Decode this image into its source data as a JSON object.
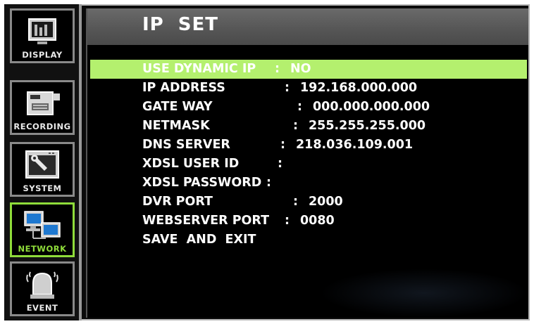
{
  "sidebar": {
    "items": [
      {
        "label": "DISPLAY",
        "icon": "display-icon",
        "active": false
      },
      {
        "label": "RECORDING",
        "icon": "camera-icon",
        "active": false
      },
      {
        "label": "SYSTEM",
        "icon": "wrench-icon",
        "active": false
      },
      {
        "label": "NETWORK",
        "icon": "network-icon",
        "active": true
      },
      {
        "label": "EVENT",
        "icon": "alarm-icon",
        "active": false
      }
    ]
  },
  "panel": {
    "title": "IP SET",
    "rows": [
      {
        "key": "USE DYNAMIC IP",
        "colon": ":",
        "value": "NO",
        "selected": true
      },
      {
        "key": "IP ADDRESS",
        "colon": ":",
        "value": "192.168.000.000"
      },
      {
        "key": "GATE WAY",
        "colon": ":",
        "value": "000.000.000.000"
      },
      {
        "key": "NETMASK",
        "colon": ":",
        "value": "255.255.255.000"
      },
      {
        "key": "DNS SERVER",
        "colon": ":",
        "value": "218.036.109.001"
      },
      {
        "key": "XDSL USER ID",
        "colon": ":",
        "value": ""
      },
      {
        "key": "XDSL PASSWORD",
        "colon": ":",
        "value": ""
      },
      {
        "key": "DVR PORT",
        "colon": ":",
        "value": "2000"
      },
      {
        "key": "WEBSERVER PORT",
        "colon": ":",
        "value": "0080"
      },
      {
        "key": "SAVE  AND  EXIT",
        "colon": "",
        "value": ""
      }
    ]
  },
  "colors": {
    "accent": "#8fdc3a",
    "selected_bg": "#b4f06e"
  }
}
